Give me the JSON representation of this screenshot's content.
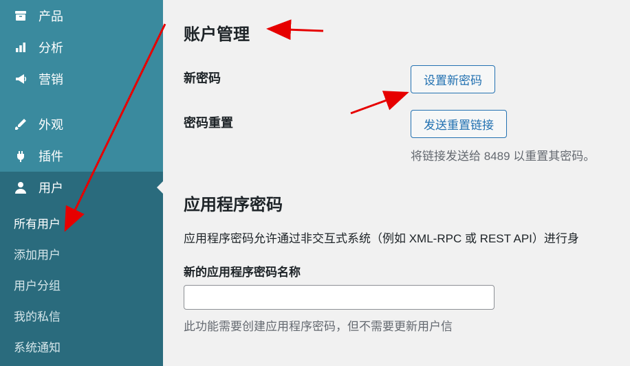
{
  "sidebar": {
    "items": [
      {
        "label": "产品"
      },
      {
        "label": "分析"
      },
      {
        "label": "营销"
      },
      {
        "label": "外观"
      },
      {
        "label": "插件"
      },
      {
        "label": "用户"
      }
    ],
    "submenu": [
      {
        "label": "所有用户"
      },
      {
        "label": "添加用户"
      },
      {
        "label": "用户分组"
      },
      {
        "label": "我的私信"
      },
      {
        "label": "系统通知"
      }
    ]
  },
  "main": {
    "account_title": "账户管理",
    "new_password_label": "新密码",
    "set_new_password_btn": "设置新密码",
    "reset_password_label": "密码重置",
    "send_reset_link_btn": "发送重置链接",
    "reset_helper": "将链接发送给 8489 以重置其密码。",
    "app_pwd_title": "应用程序密码",
    "app_pwd_desc": "应用程序密码允许通过非交互式系统（例如 XML-RPC 或 REST API）进行身",
    "app_pwd_field_label": "新的应用程序密码名称",
    "app_pwd_field_value": "",
    "app_pwd_field_helper": "此功能需要创建应用程序密码，但不需要更新用户信"
  }
}
